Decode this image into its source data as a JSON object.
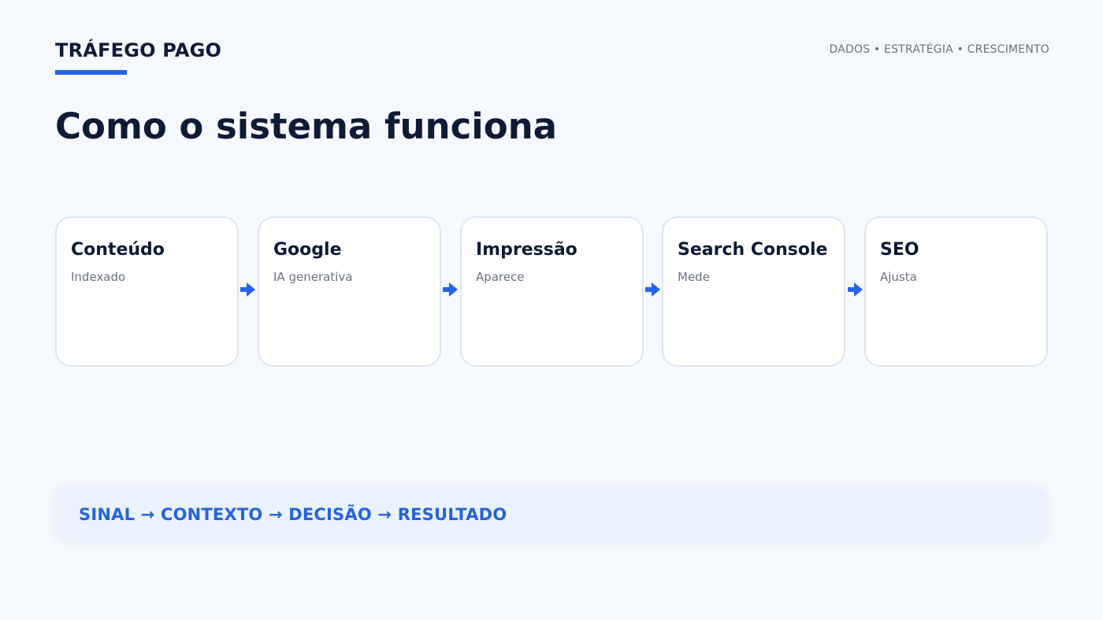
{
  "header": {
    "brand": "TRÁFEGO PAGO",
    "tagline": "DADOS • ESTRATÉGIA • CRESCIMENTO"
  },
  "page_title": "Como o sistema funciona",
  "steps": [
    {
      "title": "Conteúdo",
      "subtitle": "Indexado"
    },
    {
      "title": "Google",
      "subtitle": "IA generativa"
    },
    {
      "title": "Impressão",
      "subtitle": "Aparece"
    },
    {
      "title": "Search Console",
      "subtitle": "Mede"
    },
    {
      "title": "SEO",
      "subtitle": "Ajusta"
    }
  ],
  "banner": {
    "text": "SINAL → CONTEXTO → DECISÃO → RESULTADO"
  },
  "colors": {
    "accent": "#2563eb",
    "heading": "#0d1b36",
    "muted": "#6b7280",
    "background": "#f6f9fd"
  },
  "icons": {
    "connector": "arrow-right-icon"
  }
}
